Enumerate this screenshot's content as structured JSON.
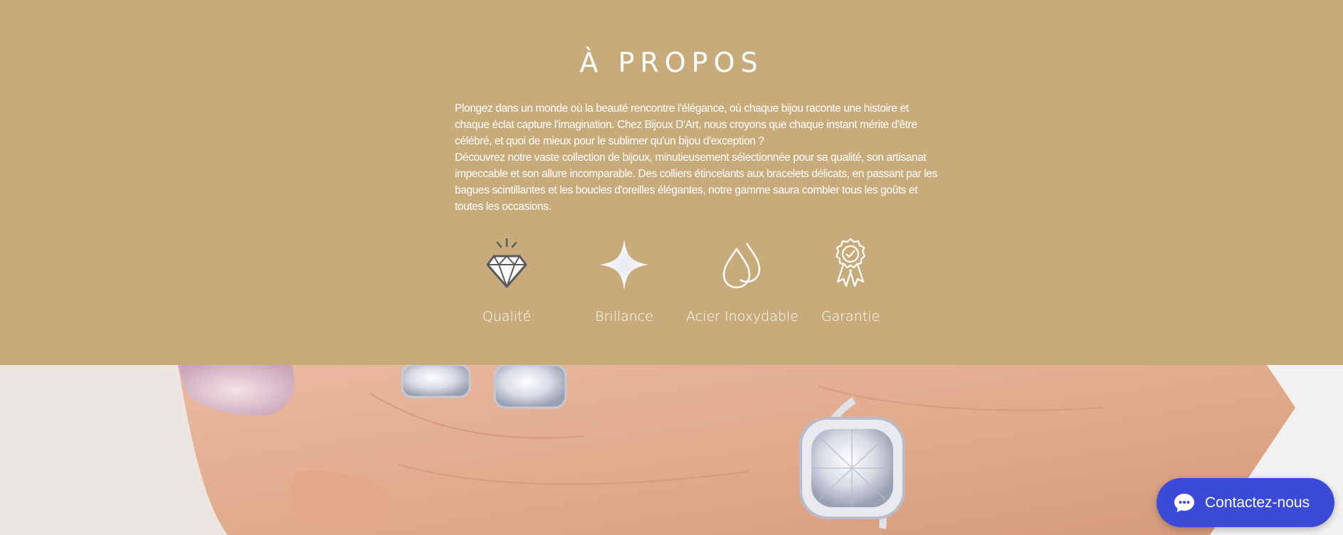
{
  "about": {
    "title": "À PROPOS",
    "paragraph_1": "Plongez dans un monde où la beauté rencontre l'élégance, où chaque bijou raconte une histoire et chaque éclat capture l'imagination. Chez Bijoux D'Art, nous croyons que chaque instant mérite d'être célébré, et quoi de mieux pour le sublimer qu'un bijou d'exception ?",
    "paragraph_2": "Découvrez notre vaste collection de bijoux, minutieusement sélectionnée pour sa qualité, son artisanat impeccable et son allure incomparable. Des colliers étincelants aux bracelets délicats, en passant par les bagues scintillantes et les boucles d'oreilles élégantes, notre gamme saura combler tous les goûts et toutes les occasions."
  },
  "features": [
    {
      "label": "Qualité",
      "icon": "diamond-icon"
    },
    {
      "label": "Brillance",
      "icon": "sparkle-icon"
    },
    {
      "label": "Acier Inoxydable",
      "icon": "drops-icon"
    },
    {
      "label": "Garantie",
      "icon": "award-badge-icon"
    }
  ],
  "chat": {
    "label": "Contactez-nous",
    "icon": "chat-bubble-icon"
  },
  "colors": {
    "section_background": "#c7ab7a",
    "text": "#ffffff",
    "chat_button": "#3b4bd8"
  }
}
